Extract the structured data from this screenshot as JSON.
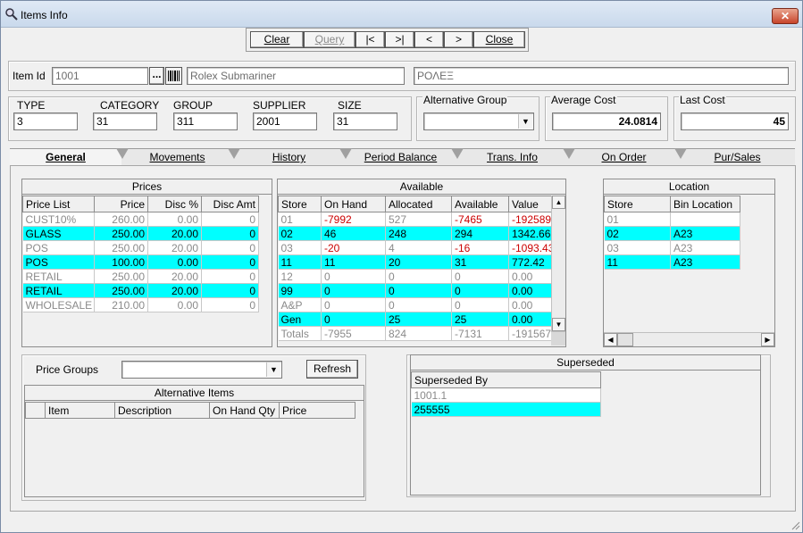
{
  "window": {
    "title": "Items Info",
    "close_label": "✕"
  },
  "toolbar": {
    "clear": "Clear",
    "query": "Query",
    "first": "|<",
    "last": ">|",
    "prev": "<",
    "next": ">",
    "close": "Close"
  },
  "item": {
    "id_label": "Item Id",
    "id_value": "1001",
    "browse_label": "...",
    "name": "Rolex Submariner",
    "alt_name": "ΡΟΛΕΞ"
  },
  "attributes": {
    "type_label": "TYPE",
    "type_value": "3",
    "category_label": "CATEGORY",
    "category_value": "31",
    "group_label": "GROUP",
    "group_value": "311",
    "supplier_label": "SUPPLIER",
    "supplier_value": "2001",
    "size_label": "SIZE",
    "size_value": "31",
    "alt_group_label": "Alternative Group",
    "alt_group_value": "",
    "avg_cost_label": "Average Cost",
    "avg_cost_value": "24.0814",
    "last_cost_label": "Last Cost",
    "last_cost_value": "45"
  },
  "tabs": [
    "General",
    "Movements",
    "History",
    "Period Balance",
    "Trans. Info",
    "On Order",
    "Pur/Sales"
  ],
  "prices": {
    "title": "Prices",
    "columns": [
      "Price List",
      "Price",
      "Disc %",
      "Disc Amt"
    ],
    "rows": [
      {
        "list": "CUST10%",
        "price": "260.00",
        "disc": "0.00",
        "amt": "0",
        "style": "gr"
      },
      {
        "list": "GLASS",
        "price": "250.00",
        "disc": "20.00",
        "amt": "0",
        "style": "hl"
      },
      {
        "list": "POS",
        "price": "250.00",
        "disc": "20.00",
        "amt": "0",
        "style": "gr"
      },
      {
        "list": "POS",
        "price": "100.00",
        "disc": "0.00",
        "amt": "0",
        "style": "hl"
      },
      {
        "list": "RETAIL",
        "price": "250.00",
        "disc": "20.00",
        "amt": "0",
        "style": "gr"
      },
      {
        "list": "RETAIL",
        "price": "250.00",
        "disc": "20.00",
        "amt": "0",
        "style": "hl"
      },
      {
        "list": "WHOLESALE",
        "price": "210.00",
        "disc": "0.00",
        "amt": "0",
        "style": "gr"
      }
    ]
  },
  "available": {
    "title": "Available",
    "columns": [
      "Store",
      "On Hand",
      "Allocated",
      "Available",
      "Value"
    ],
    "rows": [
      {
        "store": "01",
        "on_hand": "-7992",
        "allocated": "527",
        "available": "-7465",
        "value": "-192589.",
        "style": "gr",
        "neg": true
      },
      {
        "store": "02",
        "on_hand": "46",
        "allocated": "248",
        "available": "294",
        "value": "1342.66",
        "style": "hl",
        "neg": false
      },
      {
        "store": "03",
        "on_hand": "-20",
        "allocated": "4",
        "available": "-16",
        "value": "-1093.43",
        "style": "gr",
        "neg": true
      },
      {
        "store": "11",
        "on_hand": "11",
        "allocated": "20",
        "available": "31",
        "value": "772.42",
        "style": "hl",
        "neg": false
      },
      {
        "store": "12",
        "on_hand": "0",
        "allocated": "0",
        "available": "0",
        "value": "0.00",
        "style": "gr",
        "neg": false
      },
      {
        "store": "99",
        "on_hand": "0",
        "allocated": "0",
        "available": "0",
        "value": "0.00",
        "style": "hl",
        "neg": false
      },
      {
        "store": "A&P",
        "on_hand": "0",
        "allocated": "0",
        "available": "0",
        "value": "0.00",
        "style": "gr",
        "neg": false
      },
      {
        "store": "Gen",
        "on_hand": "0",
        "allocated": "25",
        "available": "25",
        "value": "0.00",
        "style": "hl",
        "neg": false
      },
      {
        "store": "Totals",
        "on_hand": "-7955",
        "allocated": "824",
        "available": "-7131",
        "value": "-191567.",
        "style": "gr",
        "neg": false
      }
    ]
  },
  "location": {
    "title": "Location",
    "columns": [
      "Store",
      "Bin Location"
    ],
    "rows": [
      {
        "store": "01",
        "bin": "",
        "style": "gr"
      },
      {
        "store": "02",
        "bin": "A23",
        "style": "hl"
      },
      {
        "store": "03",
        "bin": "A23",
        "style": "gr"
      },
      {
        "store": "11",
        "bin": "A23",
        "style": "hl"
      }
    ]
  },
  "price_groups": {
    "label": "Price Groups",
    "value": "",
    "refresh": "Refresh"
  },
  "alt_items": {
    "title": "Alternative Items",
    "columns": [
      "Item",
      "Description",
      "On Hand Qty",
      "Price"
    ]
  },
  "superseded": {
    "title": "Superseded",
    "column": "Superseded By",
    "rows": [
      {
        "value": "1001.1",
        "style": "gr"
      },
      {
        "value": "255555",
        "style": "hl"
      }
    ]
  }
}
